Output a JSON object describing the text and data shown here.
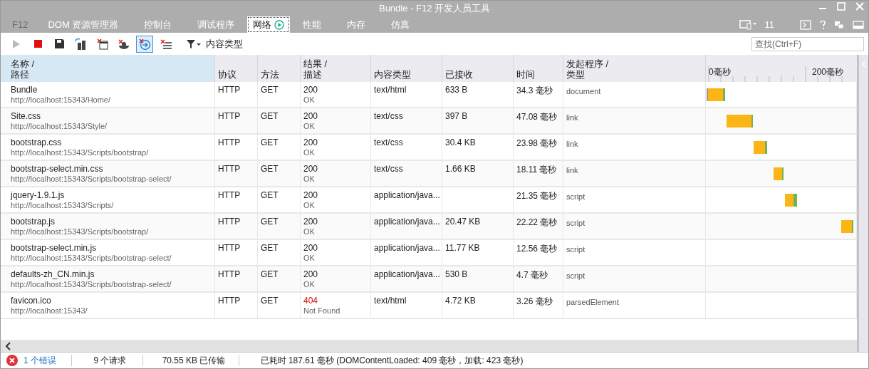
{
  "window": {
    "title": "Bundle - F12 开发人员工具"
  },
  "tabs": [
    {
      "label": "F12",
      "selected": false,
      "disabled": true
    },
    {
      "label": "DOM 资源管理器",
      "selected": false,
      "disabled": false
    },
    {
      "label": "控制台",
      "selected": false,
      "disabled": false
    },
    {
      "label": "调试程序",
      "selected": false,
      "disabled": false
    },
    {
      "label": "网络",
      "selected": true,
      "disabled": false
    },
    {
      "label": "性能",
      "selected": false,
      "disabled": false
    },
    {
      "label": "内存",
      "selected": false,
      "disabled": false
    },
    {
      "label": "仿真",
      "selected": false,
      "disabled": false
    }
  ],
  "document_mode": "11",
  "toolbar": {
    "buttons": [
      {
        "kind": "play",
        "on": false,
        "disabled": true
      },
      {
        "kind": "stop",
        "on": false,
        "disabled": false
      },
      {
        "kind": "save",
        "on": false,
        "disabled": false
      },
      {
        "kind": "cache",
        "on": false,
        "disabled": false
      },
      {
        "kind": "clear-entries",
        "on": false,
        "disabled": false
      },
      {
        "kind": "clear-cookies",
        "on": false,
        "disabled": false
      },
      {
        "kind": "navigate",
        "on": true,
        "disabled": false
      },
      {
        "kind": "clear-list",
        "on": false,
        "disabled": false
      }
    ],
    "filter": "内容类型",
    "search": {
      "placeholder": "查找(Ctrl+F)"
    }
  },
  "table": {
    "columns": [
      {
        "label": "名称 /",
        "sublabel": "路径",
        "sorted": true
      },
      {
        "label": "协议",
        "sorted": false
      },
      {
        "label": "方法",
        "sorted": false
      },
      {
        "label": "结果 /",
        "sublabel": "描述",
        "sorted": false
      },
      {
        "label": "内容类型",
        "sorted": false
      },
      {
        "label": "已接收",
        "sorted": false
      },
      {
        "label": "时间",
        "sorted": false
      },
      {
        "label": "发起程序 /",
        "sublabel": "类型",
        "sorted": false
      }
    ],
    "timeline_ticks": [
      "0毫秒",
      "200毫秒"
    ],
    "rows": [
      {
        "name": "Bundle",
        "path": "http://localhost:15343/Home/",
        "protocol": "HTTP",
        "method": "GET",
        "result": "200",
        "description": "OK",
        "error": false,
        "content_type": "text/html",
        "received": "633 B",
        "time": "34.3 毫秒",
        "initiator": "document"
      },
      {
        "name": "Site.css",
        "path": "http://localhost:15343/Style/",
        "protocol": "HTTP",
        "method": "GET",
        "result": "200",
        "description": "OK",
        "error": false,
        "content_type": "text/css",
        "received": "397 B",
        "time": "47.08 毫秒",
        "initiator": "link"
      },
      {
        "name": "bootstrap.css",
        "path": "http://localhost:15343/Scripts/bootstrap/",
        "protocol": "HTTP",
        "method": "GET",
        "result": "200",
        "description": "OK",
        "error": false,
        "content_type": "text/css",
        "received": "30.4 KB",
        "time": "23.98 毫秒",
        "initiator": "link"
      },
      {
        "name": "bootstrap-select.min.css",
        "path": "http://localhost:15343/Scripts/bootstrap-select/",
        "protocol": "HTTP",
        "method": "GET",
        "result": "200",
        "description": "OK",
        "error": false,
        "content_type": "text/css",
        "received": "1.66 KB",
        "time": "18.11 毫秒",
        "initiator": "link"
      },
      {
        "name": "jquery-1.9.1.js",
        "path": "http://localhost:15343/Scripts/",
        "protocol": "HTTP",
        "method": "GET",
        "result": "200",
        "description": "OK",
        "error": false,
        "content_type": "application/java...",
        "time": "21.35 毫秒",
        "initiator": "script"
      },
      {
        "name": "bootstrap.js",
        "path": "http://localhost:15343/Scripts/bootstrap/",
        "protocol": "HTTP",
        "method": "GET",
        "result": "200",
        "description": "OK",
        "error": false,
        "content_type": "application/java...",
        "received": "20.47 KB",
        "time": "22.22 毫秒",
        "initiator": "script"
      },
      {
        "name": "bootstrap-select.min.js",
        "path": "http://localhost:15343/Scripts/bootstrap-select/",
        "protocol": "HTTP",
        "method": "GET",
        "result": "200",
        "description": "OK",
        "error": false,
        "content_type": "application/java...",
        "received": "11.77 KB",
        "time": "12.56 毫秒",
        "initiator": "script"
      },
      {
        "name": "defaults-zh_CN.min.js",
        "path": "http://localhost:15343/Scripts/bootstrap-select/",
        "protocol": "HTTP",
        "method": "GET",
        "result": "200",
        "description": "OK",
        "error": false,
        "content_type": "application/java...",
        "received": "530 B",
        "time": "4.7 毫秒",
        "initiator": "script"
      },
      {
        "name": "favicon.ico",
        "path": "http://localhost:15343/",
        "protocol": "HTTP",
        "method": "GET",
        "result": "404",
        "description": "Not Found",
        "error": true,
        "content_type": "text/html",
        "received": "4.72 KB",
        "time": "3.26 毫秒",
        "initiator": "parsedElement"
      }
    ]
  },
  "status_bar": {
    "errors": "1 个错误",
    "requests": "9 个请求",
    "transferred": "70.55 KB 已传输",
    "elapsed": "已耗时 187.61 毫秒 (DOMContentLoaded: 409 毫秒，加载: 423 毫秒)"
  }
}
